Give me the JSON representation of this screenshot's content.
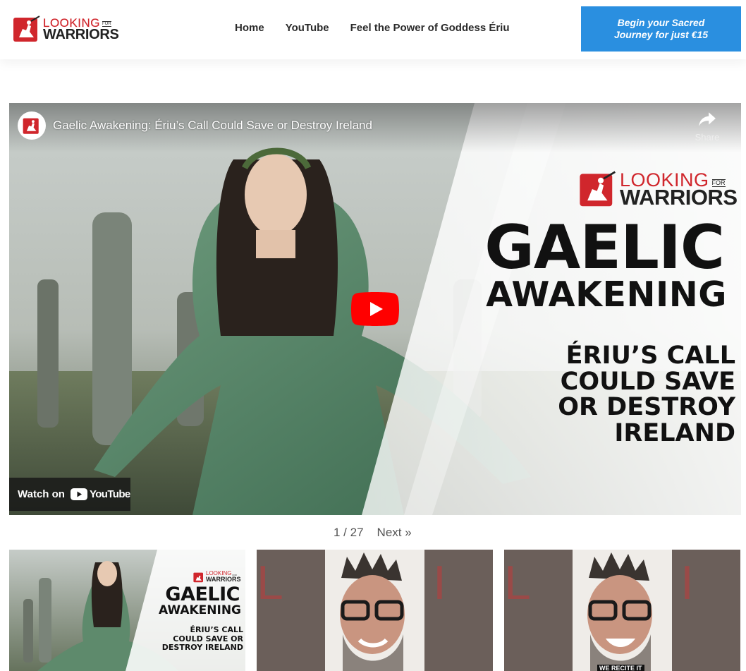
{
  "header": {
    "logo": {
      "line1": "LOOKING",
      "for": "FOR",
      "line2": "WARRIORS"
    },
    "nav": [
      {
        "label": "Home"
      },
      {
        "label": "YouTube"
      },
      {
        "label": "Feel the Power of Goddess Ériu"
      }
    ],
    "cta_label": "Begin your Sacred Journey for just €15"
  },
  "video": {
    "title": "Gaelic Awakening: Ériu’s Call Could Save or Destroy Ireland",
    "share_label": "Share",
    "watch_on_label": "Watch on",
    "youtube_label": "YouTube",
    "thumbnail": {
      "logo_line1": "LOOKING",
      "logo_for": "FOR",
      "logo_line2": "WARRIORS",
      "headline_1": "GAELIC",
      "headline_2": "AWAKENING",
      "headline_3": "ÉRIU’S CALL COULD SAVE OR DESTROY IRELAND"
    }
  },
  "pagination": {
    "current": "1 / 27",
    "next_label": "Next »"
  },
  "gallery": {
    "tiles": [
      {
        "logo_line1": "LOOKING",
        "logo_for": "FOR",
        "logo_line2": "WARRIORS",
        "headline_1": "GAELIC",
        "headline_2": "AWAKENING",
        "headline_3": "ÉRIU’S CALL COULD SAVE OR DESTROY IRELAND"
      },
      {
        "background_text": "LOOKI"
      },
      {
        "background_text": "LOOKI",
        "caption": "WE RECITE IT"
      }
    ]
  },
  "colors": {
    "brand_red": "#d0262c",
    "cta_blue": "#2a8fe0",
    "youtube_red": "#ff0000"
  },
  "icons": [
    "logo-mark-icon",
    "share-icon",
    "play-icon",
    "youtube-icon"
  ]
}
